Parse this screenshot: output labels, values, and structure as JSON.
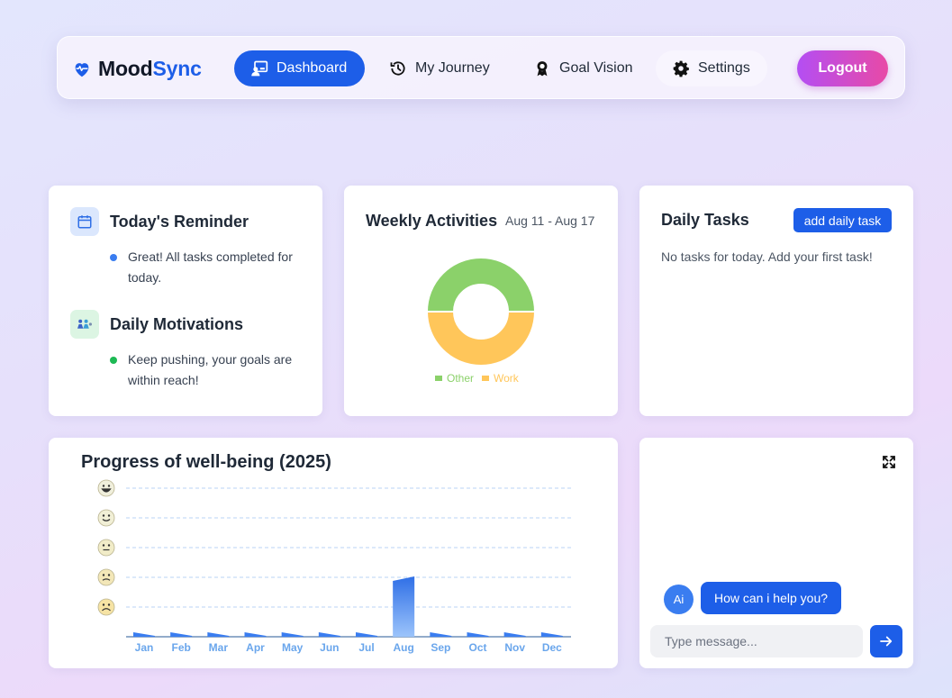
{
  "brand": {
    "name_part1": "Mood",
    "name_part2": "Sync",
    "icon": "heart-pulse-icon"
  },
  "nav": {
    "items": [
      {
        "label": "Dashboard",
        "icon": "dashboard-icon",
        "active": true
      },
      {
        "label": "My Journey",
        "icon": "history-icon",
        "active": false
      },
      {
        "label": "Goal Vision",
        "icon": "award-icon",
        "active": false
      },
      {
        "label": "Settings",
        "icon": "gear-icon",
        "active": false
      }
    ],
    "logout_label": "Logout"
  },
  "reminder": {
    "title": "Today's Reminder",
    "text": "Great! All tasks completed for today.",
    "icon": "calendar-icon"
  },
  "motivation": {
    "title": "Daily Motivations",
    "text": "Keep pushing, your goals are within reach!",
    "icon": "people-icon"
  },
  "weekly": {
    "title": "Weekly Activities",
    "date_range": "Aug 11 - Aug 17",
    "legend": [
      {
        "label": "Other",
        "color": "#8bd16a"
      },
      {
        "label": "Work",
        "color": "#ffc65a"
      }
    ]
  },
  "tasks": {
    "title": "Daily Tasks",
    "add_label": "add daily task",
    "empty_text": "No tasks for today. Add your first task!"
  },
  "progress": {
    "title": "Progress of well-being (2025)"
  },
  "chat": {
    "avatar_label": "Ai",
    "message": "How can i help you?",
    "input_placeholder": "Type message..."
  },
  "colors": {
    "primary": "#1d5ee8",
    "logout_from": "#b44ef3",
    "logout_to": "#e84aa6",
    "bar": "#4f8ff0"
  },
  "chart_data": [
    {
      "type": "pie",
      "categories": [
        "Other",
        "Work"
      ],
      "values": [
        50,
        50
      ],
      "colors": [
        "#8bd16a",
        "#ffc65a"
      ],
      "donut": true,
      "legend": "bottom"
    },
    {
      "type": "bar",
      "title": "Progress of well-being (2025)",
      "categories": [
        "Jan",
        "Feb",
        "Mar",
        "Apr",
        "May",
        "Jun",
        "Jul",
        "Aug",
        "Sep",
        "Oct",
        "Nov",
        "Dec"
      ],
      "values": [
        0,
        0,
        0,
        0,
        0,
        0,
        0,
        2,
        0,
        0,
        0,
        0
      ],
      "ylim": [
        0,
        5
      ],
      "y_ticks": [
        "very-sad",
        "sad",
        "neutral",
        "happy",
        "very-happy"
      ],
      "grid": true
    }
  ]
}
